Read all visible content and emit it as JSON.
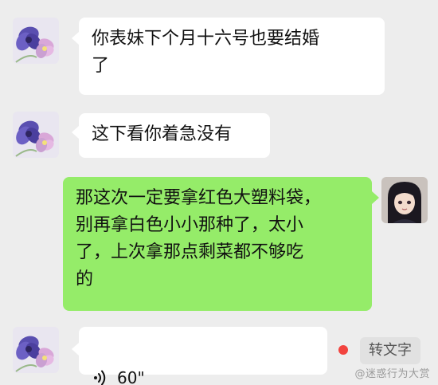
{
  "messages": [
    {
      "side": "in",
      "type": "text",
      "text": "你表妹下个月十六号也要结婚\n了",
      "avatar": "purple-flower-avatar"
    },
    {
      "side": "in",
      "type": "text",
      "text": "这下看你着急没有",
      "avatar": "purple-flower-avatar"
    },
    {
      "side": "out",
      "type": "text",
      "text": "那这次一定要拿红色大塑料袋，\n别再拿白色小小那种了，太小\n了，上次拿那点剩菜都不够吃\n的",
      "avatar": "anime-girl-avatar"
    },
    {
      "side": "in",
      "type": "voice",
      "duration": "60\"",
      "avatar": "purple-flower-avatar"
    }
  ],
  "voice_actions": {
    "transcribe_label": "转文字"
  },
  "watermark": "@迷惑行为大赏",
  "colors": {
    "background": "#ededed",
    "incoming_bubble": "#ffffff",
    "outgoing_bubble": "#95ec69",
    "unread_dot": "#f2443f"
  }
}
